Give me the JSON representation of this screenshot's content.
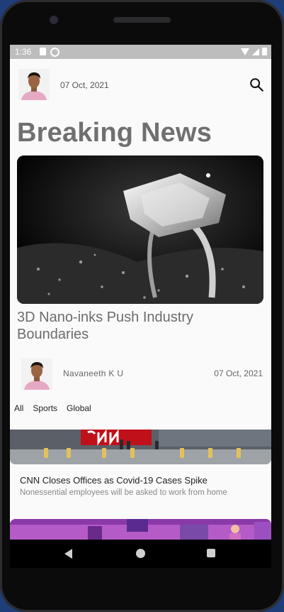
{
  "status_bar": {
    "time": "1:36"
  },
  "header": {
    "date": "07 Oct, 2021"
  },
  "title": "Breaking News",
  "featured": {
    "headline": "3D Nano-inks Push Industry Boundaries",
    "author": "Navaneeth K U",
    "date": "07 Oct, 2021"
  },
  "tabs": [
    "All",
    "Sports",
    "Global"
  ],
  "articles": [
    {
      "title": "CNN Closes Offices as Covid-19 Cases Spike",
      "description": "Nonessential employees will be asked to work from home"
    }
  ],
  "colors": {
    "status_bar": "#bdbdbd",
    "title": "#707070",
    "background": "#fafafa"
  }
}
